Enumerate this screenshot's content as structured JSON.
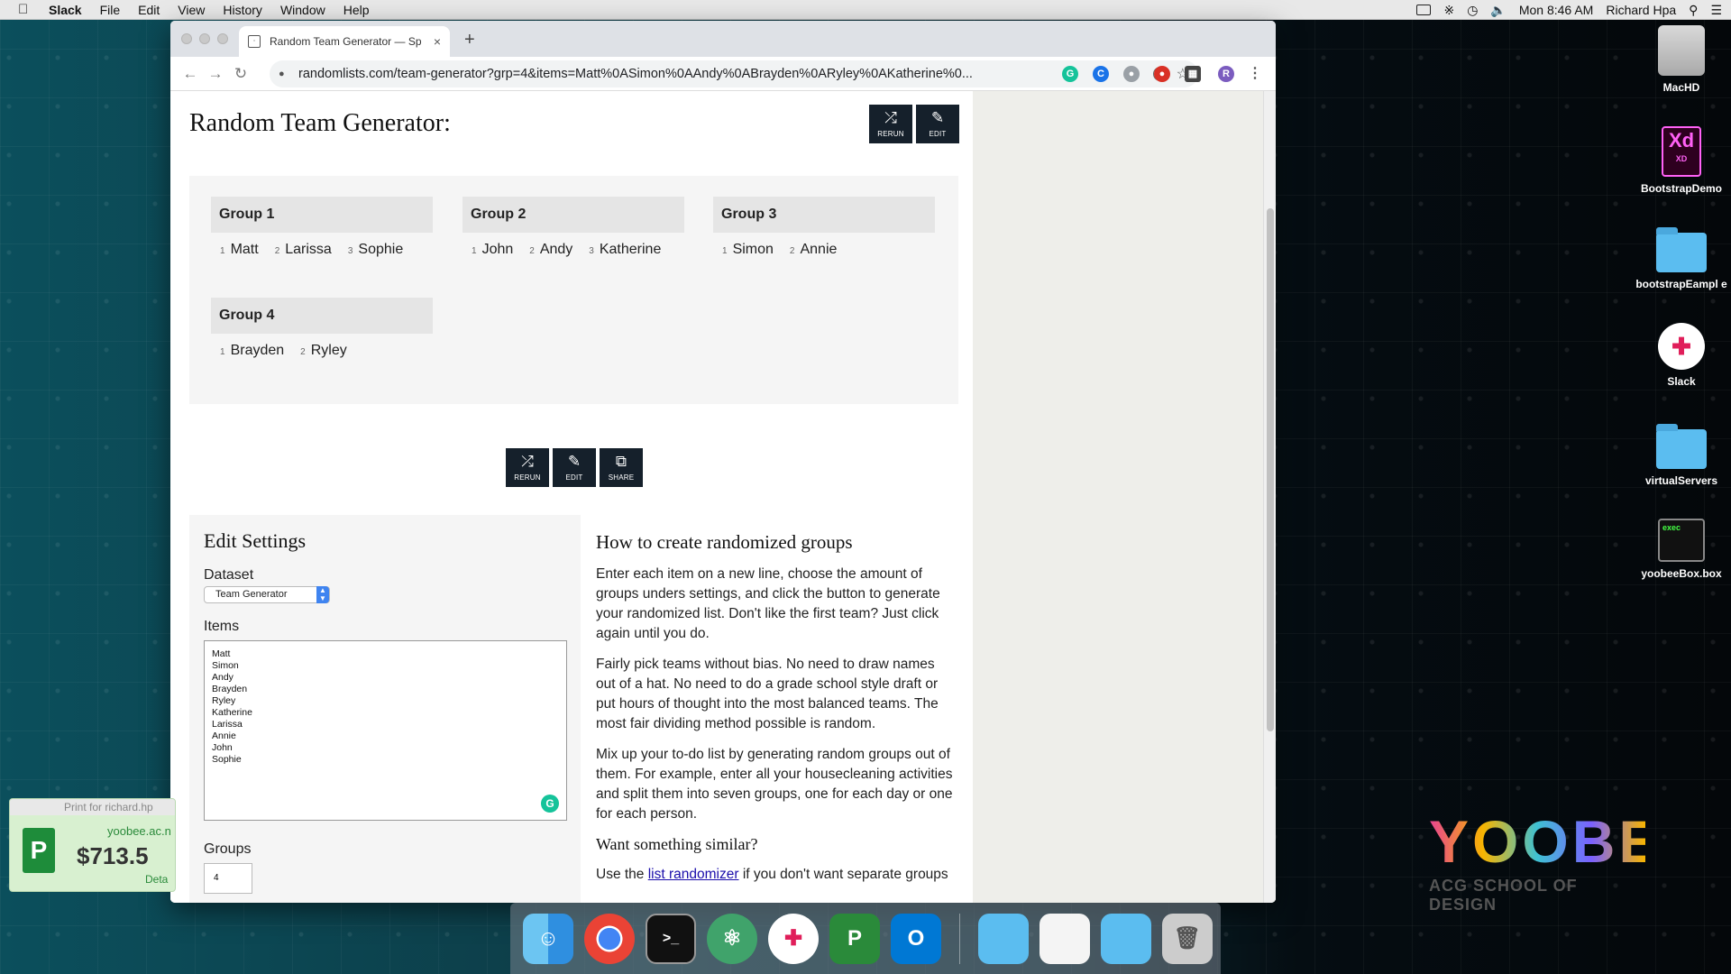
{
  "menubar": {
    "app": "Slack",
    "items": [
      "File",
      "Edit",
      "View",
      "History",
      "Window",
      "Help"
    ],
    "clock": "Mon 8:46 AM",
    "user": "Richard Hpa"
  },
  "browser": {
    "tab_title": "Random Team Generator — Sp",
    "url": "randomlists.com/team-generator?grp=4&items=Matt%0ASimon%0AAndy%0ABrayden%0ARyley%0AKatherine%0..."
  },
  "page": {
    "title": "Random Team Generator:",
    "top_buttons": {
      "rerun": "RERUN",
      "edit": "EDIT"
    },
    "bottom_buttons": {
      "rerun": "RERUN",
      "edit": "EDIT",
      "share": "SHARE"
    },
    "groups": [
      {
        "name": "Group 1",
        "members": [
          "Matt",
          "Larissa",
          "Sophie"
        ]
      },
      {
        "name": "Group 2",
        "members": [
          "John",
          "Andy",
          "Katherine"
        ]
      },
      {
        "name": "Group 3",
        "members": [
          "Simon",
          "Annie"
        ]
      },
      {
        "name": "Group 4",
        "members": [
          "Brayden",
          "Ryley"
        ]
      }
    ],
    "settings": {
      "heading": "Edit Settings",
      "dataset_label": "Dataset",
      "dataset_value": "Team Generator",
      "items_label": "Items",
      "items": [
        "Matt",
        "Simon",
        "Andy",
        "Brayden",
        "Ryley",
        "Katherine",
        "Larissa",
        "Annie",
        "John",
        "Sophie"
      ],
      "groups_label": "Groups",
      "groups_value": "4"
    },
    "howto": {
      "heading": "How to create randomized groups",
      "p1": "Enter each item on a new line, choose the amount of groups unders settings, and click the button to generate your randomized list. Don't like the first team? Just click again until you do.",
      "p2": "Fairly pick teams without bias. No need to draw names out of a hat. No need to do a grade school style draft or put hours of thought into the most balanced teams. The most fair dividing method possible is random.",
      "p3": "Mix up your to-do list by generating random groups out of them. For example, enter all your housecleaning activities and split them into seven groups, one for each day or one for each person.",
      "similar_heading": "Want something similar?",
      "p4_pre": "Use the ",
      "p4_link": "list randomizer",
      "p4_post": " if you don't want separate groups"
    }
  },
  "desktop_icons": [
    {
      "label": "MacHD",
      "icon": "hard-drive-icon"
    },
    {
      "label": "BootstrapDemo",
      "icon": "xd-file-icon",
      "badge": "Xd",
      "sub": "XD"
    },
    {
      "label": "bootstrapEampl e",
      "icon": "folder-icon"
    },
    {
      "label": "Slack",
      "icon": "slack-icon"
    },
    {
      "label": "virtualServers",
      "icon": "folder-icon"
    },
    {
      "label": "yoobeeBox.box",
      "icon": "exec-icon",
      "badge": "exec"
    }
  ],
  "print_widget": {
    "title": "Print for richard.hp",
    "domain": "yoobee.ac.n",
    "amount": "$713.5",
    "detail": "Deta"
  },
  "branding": {
    "logo": "YOOBEE",
    "sub": "ACG SCHOOL OF DESIGN"
  },
  "colors": {
    "button_dark": "#15202b",
    "panel_bg": "#f5f5f5",
    "group_header": "#e5e5e5",
    "link": "#1a0dab"
  }
}
